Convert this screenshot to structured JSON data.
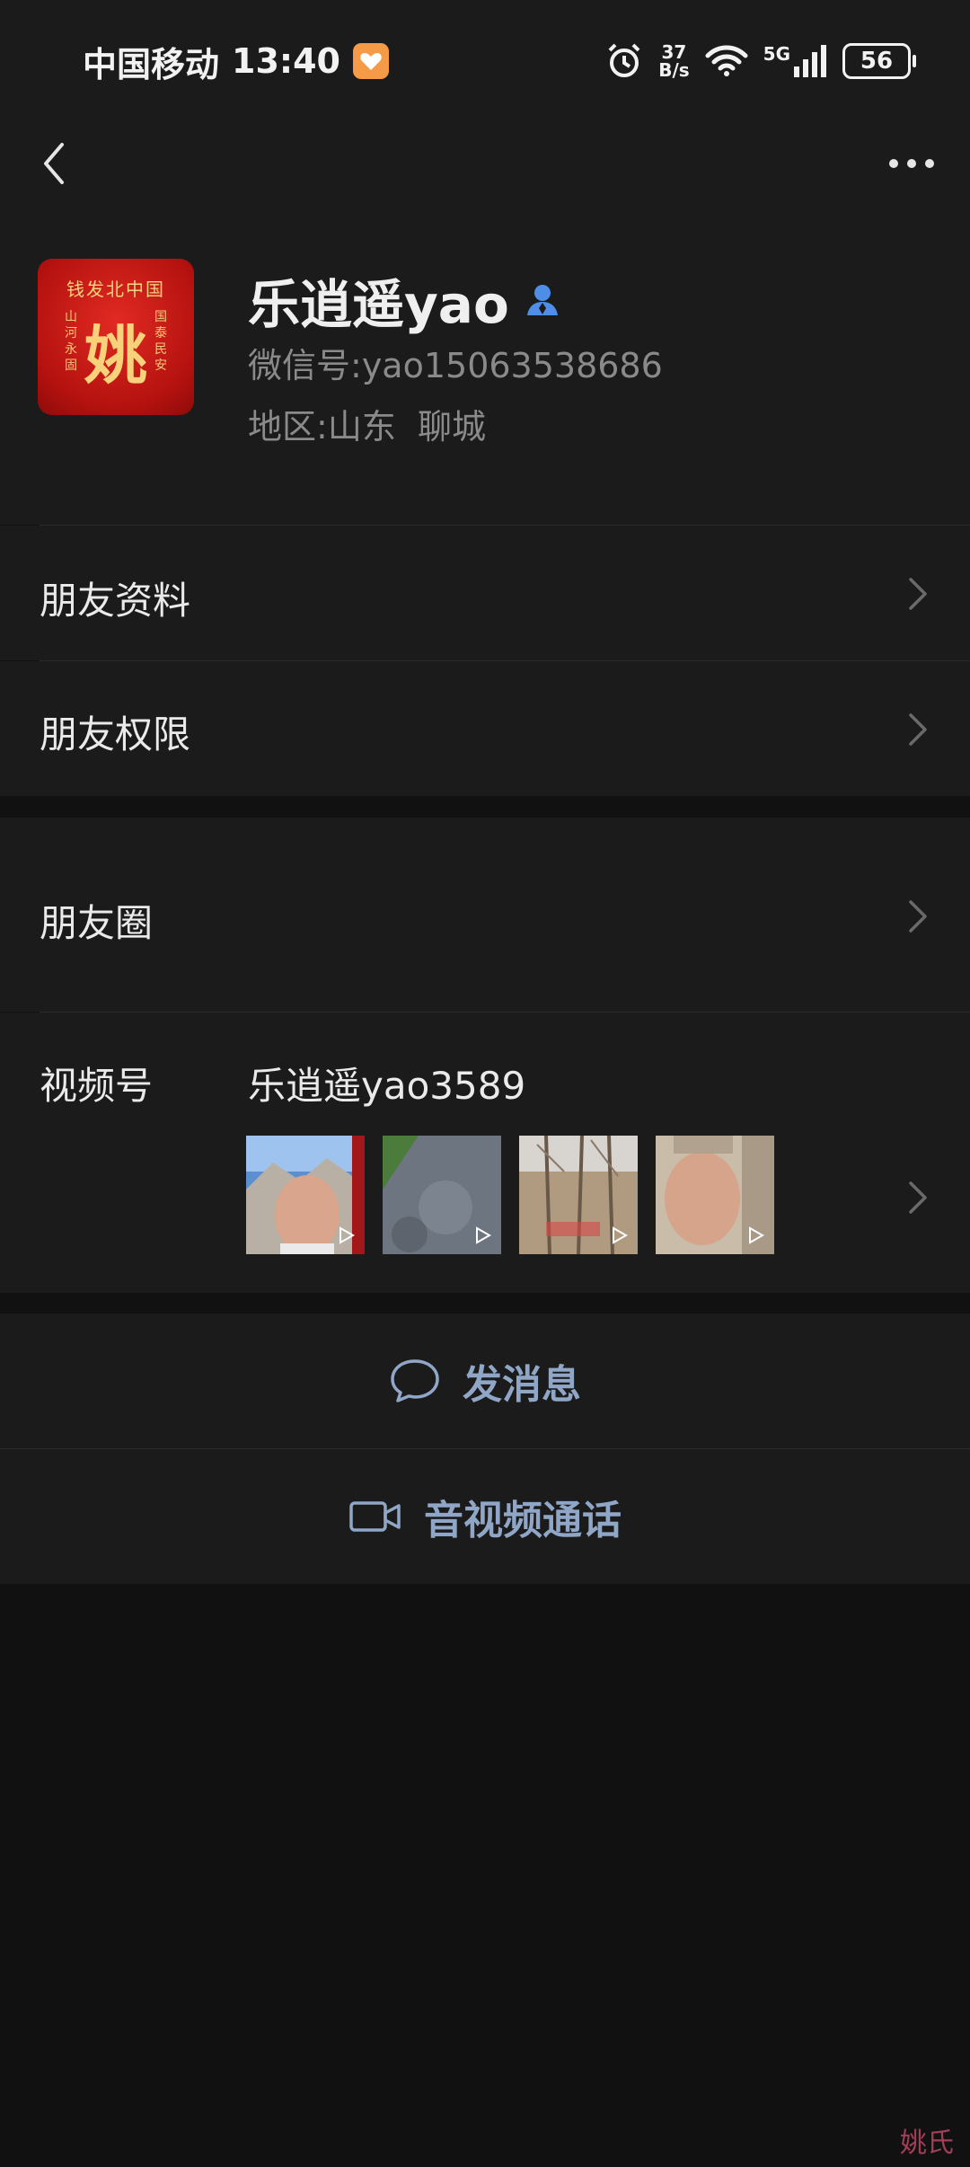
{
  "status_bar": {
    "carrier": "中国移动",
    "time": "13:40",
    "net_speed_value": "37",
    "net_speed_unit": "B/s",
    "network_type": "5G",
    "battery": "56"
  },
  "profile": {
    "nickname": "乐逍遥yao",
    "wechat_id_label": "微信号:",
    "wechat_id": "yao15063538686",
    "region_label": "地区:",
    "region": "山东  聊城",
    "avatar": {
      "banner": "钱发北中国",
      "center_char": "姚",
      "left_side": "山河永固",
      "right_side": "国泰民安"
    }
  },
  "rows": {
    "friend_info": "朋友资料",
    "friend_permissions": "朋友权限",
    "moments": "朋友圈",
    "channels_label": "视频号",
    "channels_name": "乐逍遥yao3589"
  },
  "actions": {
    "send_message": "发消息",
    "av_call": "音视频通话"
  },
  "watermark": "姚氏",
  "colors": {
    "background": "#111111",
    "surface": "#1b1b1b",
    "accent_link": "#8fa6c6",
    "verified_icon": "#4f8ee6"
  }
}
